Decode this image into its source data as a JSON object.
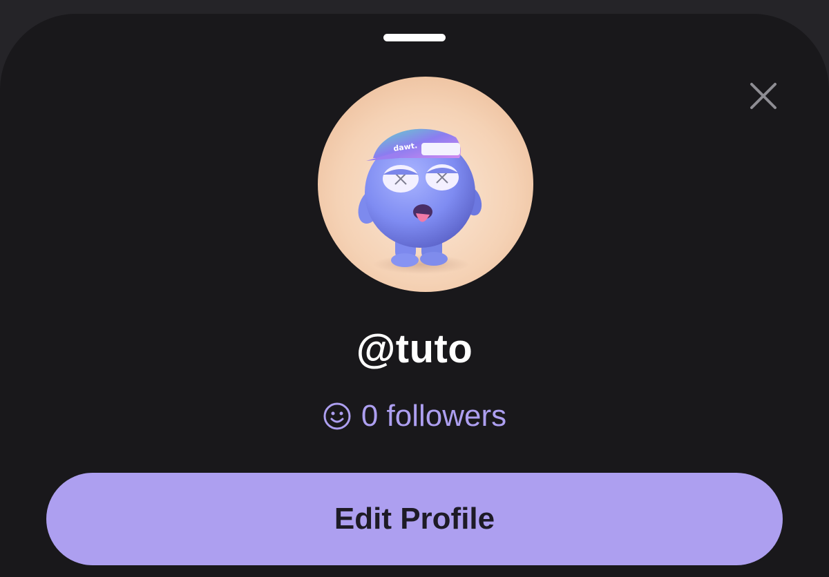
{
  "profile": {
    "username": "@tuto",
    "followers_text": "0 followers",
    "avatar_cap_text": "dawt."
  },
  "actions": {
    "edit_profile_label": "Edit Profile"
  },
  "icons": {
    "close": "close-icon",
    "followers": "smiley-icon",
    "grabber": "drag-handle"
  },
  "colors": {
    "background": "#252428",
    "sheet": "#19181b",
    "accent": "#ad9ff0",
    "button_text": "#1e1b26",
    "text": "#ffffff"
  }
}
